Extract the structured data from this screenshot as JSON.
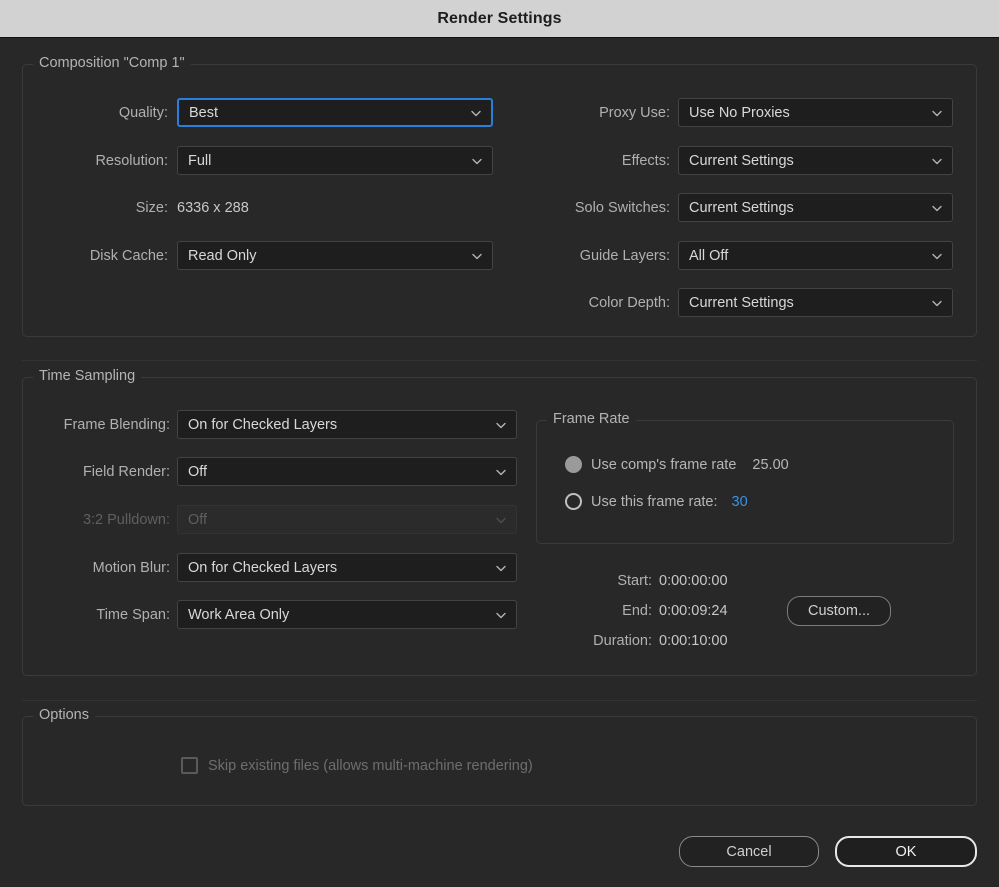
{
  "window": {
    "title": "Render Settings"
  },
  "composition": {
    "group_title": "Composition \"Comp 1\"",
    "left_fields": [
      {
        "label": "Quality:",
        "value": "Best",
        "type": "select",
        "state": "focused"
      },
      {
        "label": "Resolution:",
        "value": "Full",
        "type": "select",
        "state": "normal"
      },
      {
        "label": "Size:",
        "value": "6336 x 288",
        "type": "static",
        "state": "normal"
      },
      {
        "label": "Disk Cache:",
        "value": "Read Only",
        "type": "select",
        "state": "normal"
      }
    ],
    "right_fields": [
      {
        "label": "Proxy Use:",
        "value": "Use No Proxies",
        "type": "select",
        "state": "normal"
      },
      {
        "label": "Effects:",
        "value": "Current Settings",
        "type": "select",
        "state": "normal"
      },
      {
        "label": "Solo Switches:",
        "value": "Current Settings",
        "type": "select",
        "state": "normal"
      },
      {
        "label": "Guide Layers:",
        "value": "All Off",
        "type": "select",
        "state": "normal"
      },
      {
        "label": "Color Depth:",
        "value": "Current Settings",
        "type": "select",
        "state": "normal"
      }
    ]
  },
  "time_sampling": {
    "group_title": "Time Sampling",
    "fields": [
      {
        "label": "Frame Blending:",
        "value": "On for Checked Layers",
        "state": "normal"
      },
      {
        "label": "Field Render:",
        "value": "Off",
        "state": "normal"
      },
      {
        "label": "3:2 Pulldown:",
        "value": "Off",
        "state": "disabled"
      },
      {
        "label": "Motion Blur:",
        "value": "On for Checked Layers",
        "state": "normal"
      },
      {
        "label": "Time Span:",
        "value": "Work Area Only",
        "state": "normal"
      }
    ],
    "frame_rate": {
      "group_title": "Frame Rate",
      "option_comp": {
        "label": "Use comp's frame rate",
        "value": "25.00",
        "selected": true
      },
      "option_custom": {
        "label": "Use this frame rate:",
        "value": "30",
        "selected": false
      }
    },
    "time_info": {
      "start_label": "Start:",
      "start_value": "0:00:00:00",
      "end_label": "End:",
      "end_value": "0:00:09:24",
      "duration_label": "Duration:",
      "duration_value": "0:00:10:00",
      "custom_button": "Custom..."
    }
  },
  "options": {
    "group_title": "Options",
    "skip_existing": {
      "label": "Skip existing files (allows multi-machine rendering)",
      "checked": false,
      "state": "disabled"
    }
  },
  "footer": {
    "cancel_label": "Cancel",
    "ok_label": "OK"
  },
  "colors": {
    "background": "#282828",
    "titlebar": "#d2d2d2",
    "field_background": "#1e1e1e",
    "accent_focus": "#2a7fdc",
    "accent_link": "#3b92e8",
    "text_primary": "#d8d8d8",
    "text_label": "#b0b0b0",
    "text_disabled": "#5f5f5f"
  }
}
